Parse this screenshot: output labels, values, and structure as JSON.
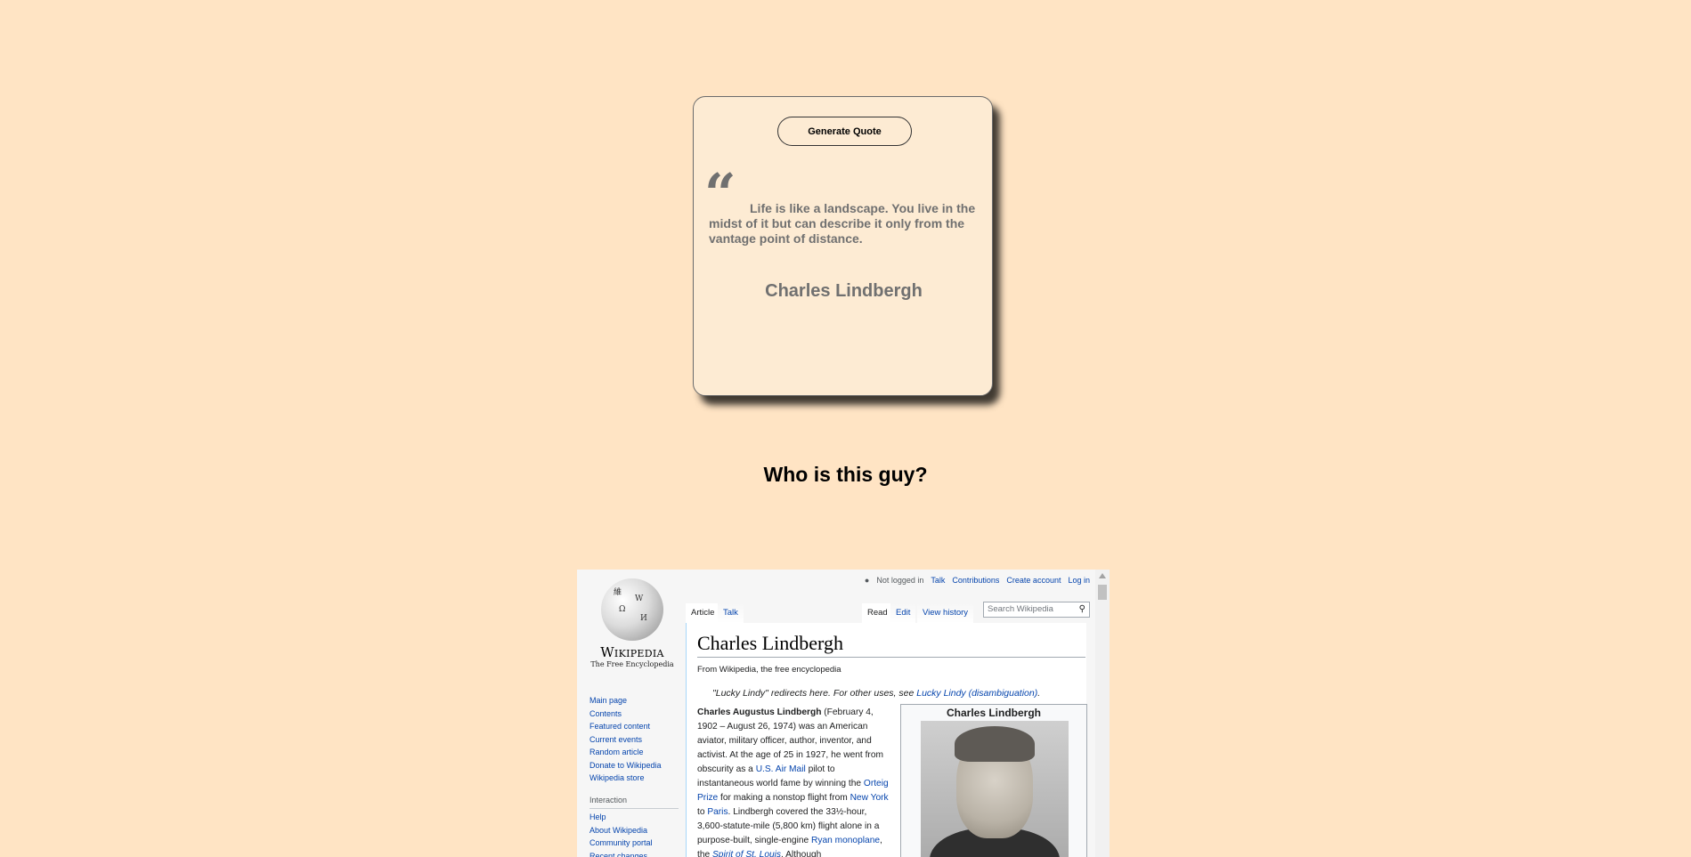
{
  "card": {
    "button_label": "Generate Quote",
    "quote_mark": "“",
    "quote": "Life is like a landscape. You live in the midst of it but can describe it only from the vantage point of distance.",
    "author": "Charles Lindbergh"
  },
  "who_heading": "Who is this guy?",
  "wiki": {
    "wordmark": "Wikipedia",
    "tagline": "The Free Encyclopedia",
    "globe_glyphs": [
      "W",
      "Ω",
      "И",
      "維"
    ],
    "sidebar": {
      "nav": [
        "Main page",
        "Contents",
        "Featured content",
        "Current events",
        "Random article",
        "Donate to Wikipedia",
        "Wikipedia store"
      ],
      "interaction_heading": "Interaction",
      "interaction": [
        "Help",
        "About Wikipedia",
        "Community portal",
        "Recent changes"
      ]
    },
    "topbar": {
      "not_logged_in": "Not logged in",
      "talk": "Talk",
      "contributions": "Contributions",
      "create_account": "Create account",
      "log_in": "Log in"
    },
    "tabs": {
      "article": "Article",
      "talk": "Talk",
      "read": "Read",
      "edit": "Edit",
      "view_history": "View history"
    },
    "search_placeholder": "Search Wikipedia",
    "title": "Charles Lindbergh",
    "from": "From Wikipedia, the free encyclopedia",
    "hatnote": {
      "text": "\"Lucky Lindy\" redirects here. For other uses, see ",
      "link": "Lucky Lindy (disambiguation)",
      "end": "."
    },
    "body": {
      "bold": "Charles Augustus Lindbergh",
      "p1": " (February 4, 1902 – August 26, 1974) was an American aviator, military officer, author, inventor, and activist. At the age of 25 in 1927, he went from obscurity as a ",
      "link1": "U.S. Air Mail",
      "p2": " pilot to instantaneous world fame by winning the ",
      "link2": "Orteig Prize",
      "p3": " for making a nonstop flight from ",
      "link3": "New York",
      "p4": " to ",
      "link4": "Paris",
      "p5": ". Lindbergh covered the 33½-hour, 3,600-statute-mile (5,800 km) flight alone in a purpose-built, single-engine ",
      "link5": "Ryan monoplane",
      "p6": ", the ",
      "link6": "Spirit of St. Louis",
      "p7": ". Although"
    },
    "infobox_title": "Charles Lindbergh"
  }
}
